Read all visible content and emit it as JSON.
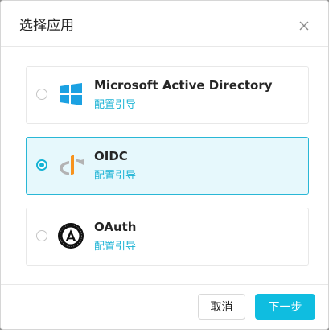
{
  "dialog": {
    "title": "选择应用",
    "close_icon": "close-icon"
  },
  "apps": [
    {
      "name": "Microsoft Active Directory",
      "guide": "配置引导",
      "selected": false,
      "icon": "windows-logo-icon",
      "icon_color": "#1ba1e2"
    },
    {
      "name": "OIDC",
      "guide": "配置引导",
      "selected": true,
      "icon": "openid-logo-icon",
      "icon_color": "#f7931e"
    },
    {
      "name": "OAuth",
      "guide": "配置引导",
      "selected": false,
      "icon": "oauth-logo-icon",
      "icon_color": "#000000"
    }
  ],
  "footer": {
    "cancel_label": "取消",
    "next_label": "下一步"
  },
  "colors": {
    "accent": "#0fbde0",
    "selected_bg": "#e6f8fc",
    "link": "#19b2d4"
  }
}
